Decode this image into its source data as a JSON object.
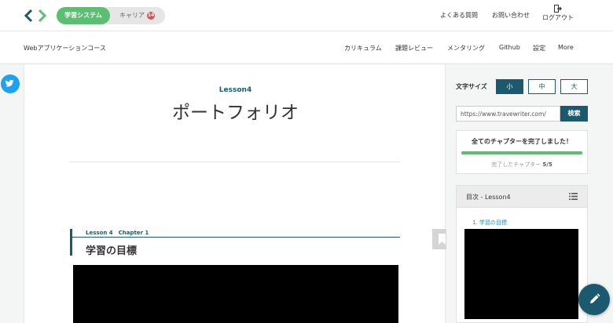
{
  "topbar": {
    "switch_active": "学習システム",
    "switch_inactive": "キャリア",
    "career_badge": "14",
    "faq": "よくある質問",
    "contact": "お問い合わせ",
    "logout": "ログアウト"
  },
  "subnav": {
    "course": "Webアプリケーションコース",
    "items": [
      "カリキュラム",
      "課題レビュー",
      "メンタリング",
      "Github",
      "設定",
      "More"
    ]
  },
  "main": {
    "lesson_label": "Lesson4",
    "lesson_title": "ポートフォリオ",
    "chapter_label": "Lesson 4　Chapter 1",
    "chapter_title": "学習の目標"
  },
  "sidebar": {
    "font_size_label": "文字サイズ",
    "font_sizes": [
      "小",
      "中",
      "大"
    ],
    "active_font_size": "小",
    "url_value": "https://www.travewriter.com/",
    "search_label": "検索",
    "progress_title": "全てのチャプターを完了しました！",
    "progress_caption": "完了したチャプター",
    "progress_count": "5/5",
    "progress_fraction": 1.0,
    "toc_title": "目次 - Lesson4",
    "toc_items": [
      "1. 学習の目標"
    ]
  },
  "colors": {
    "accent": "#1b5a6e",
    "switch_green": "#5bbf71",
    "badge_red": "#d9534f",
    "twitter_blue": "#1da1f2",
    "toc_link": "#2a8fc7"
  },
  "icons": [
    "code-logo-icon",
    "logout-icon",
    "twitter-icon",
    "bookmark-icon",
    "list-icon",
    "pencil-icon"
  ]
}
